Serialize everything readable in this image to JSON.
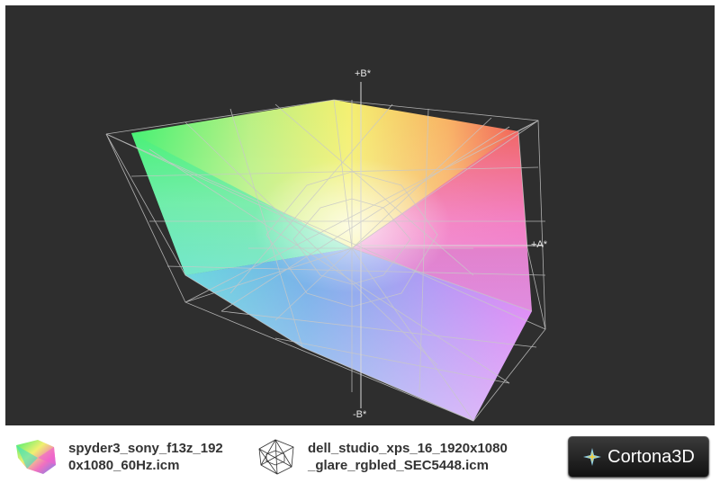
{
  "viewer": {
    "background": "#2e2e2e",
    "wire_color": "#c8c8c8",
    "axis_labels": {
      "plus_b": "+B*",
      "minus_b": "-B*",
      "plus_a": "+A*"
    }
  },
  "legend": {
    "items": [
      {
        "label_line1": "spyder3_sony_f13z_192",
        "label_line2": "0x1080_60Hz.icm",
        "icon": "color-gamut-solid-icon"
      },
      {
        "label_line1": "dell_studio_xps_16_1920x1080",
        "label_line2": "_glare_rgbled_SEC5448.icm",
        "icon": "wireframe-gamut-icon"
      }
    ],
    "brand": "Cortona3D",
    "brand_icon": "cortona-star-icon"
  }
}
